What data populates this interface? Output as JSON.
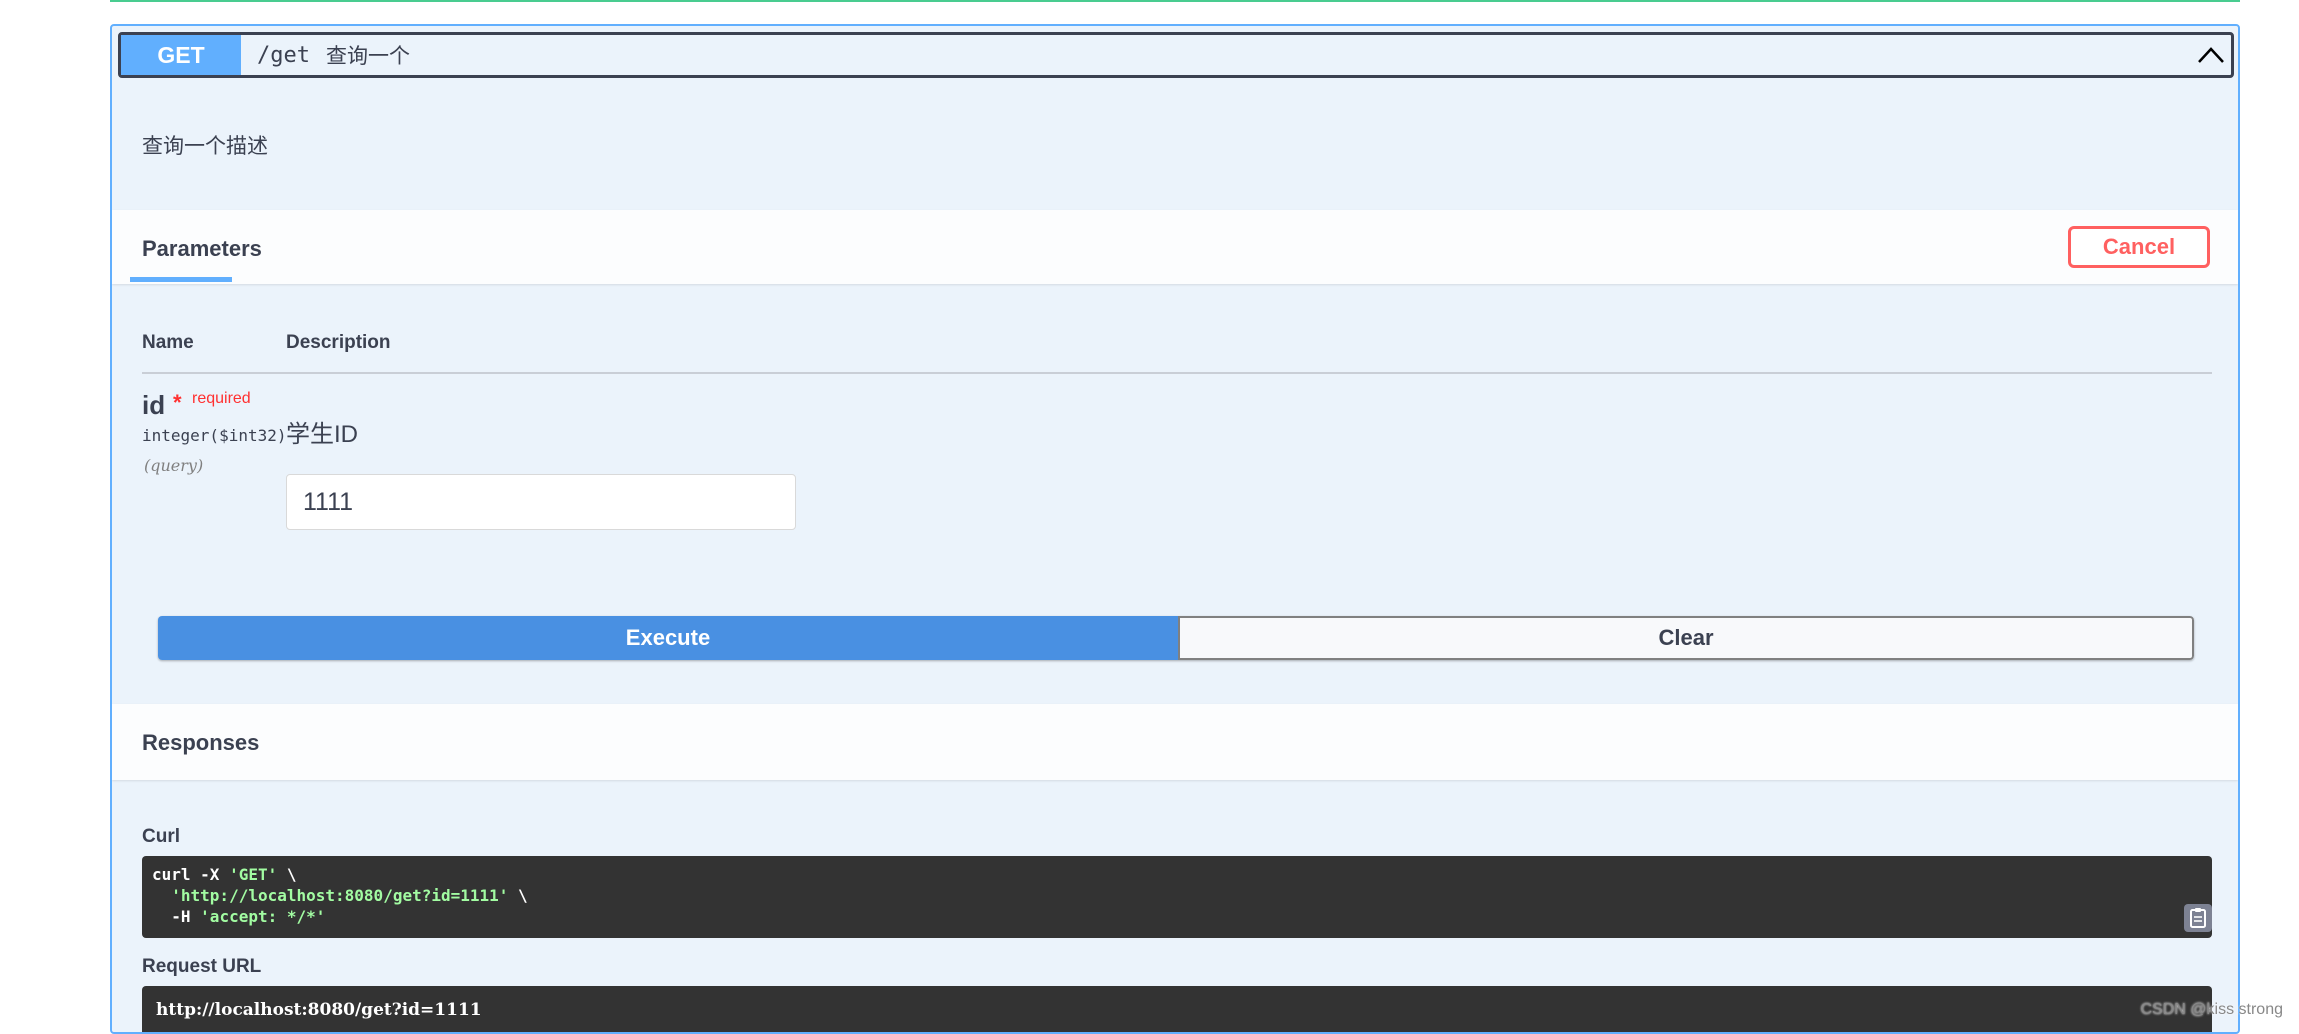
{
  "operation": {
    "method": "GET",
    "path": "/get",
    "summary": "查询一个",
    "description": "查询一个描述"
  },
  "parameters_section": {
    "tab_label": "Parameters",
    "cancel_label": "Cancel",
    "col_name": "Name",
    "col_description": "Description"
  },
  "parameter": {
    "name": "id",
    "required_star": "*",
    "required_label": "required",
    "type": "integer($int32)",
    "in": "(query)",
    "description": "学生ID",
    "value": "1111"
  },
  "actions": {
    "execute_label": "Execute",
    "clear_label": "Clear"
  },
  "responses": {
    "title": "Responses",
    "curl_label": "Curl",
    "curl_line1_cmd": "curl -X ",
    "curl_line1_method": "'GET'",
    "curl_line1_tail": " \\",
    "curl_line2_url": "'http://localhost:8080/get?id=1111'",
    "curl_line2_tail": " \\",
    "curl_line3_cmd": "  -H ",
    "curl_line3_header": "'accept: */*'",
    "request_url_label": "Request URL",
    "request_url": "http://localhost:8080/get?id=1111"
  },
  "watermark": "CSDN @kiss strong",
  "colors": {
    "get_accent": "#61affe",
    "execute": "#4990e2",
    "cancel": "#ff6060",
    "code_bg": "#333333",
    "code_string": "#a2fca2"
  },
  "icons": {
    "collapse": "chevron-up-icon",
    "copy": "copy-clipboard-icon"
  }
}
